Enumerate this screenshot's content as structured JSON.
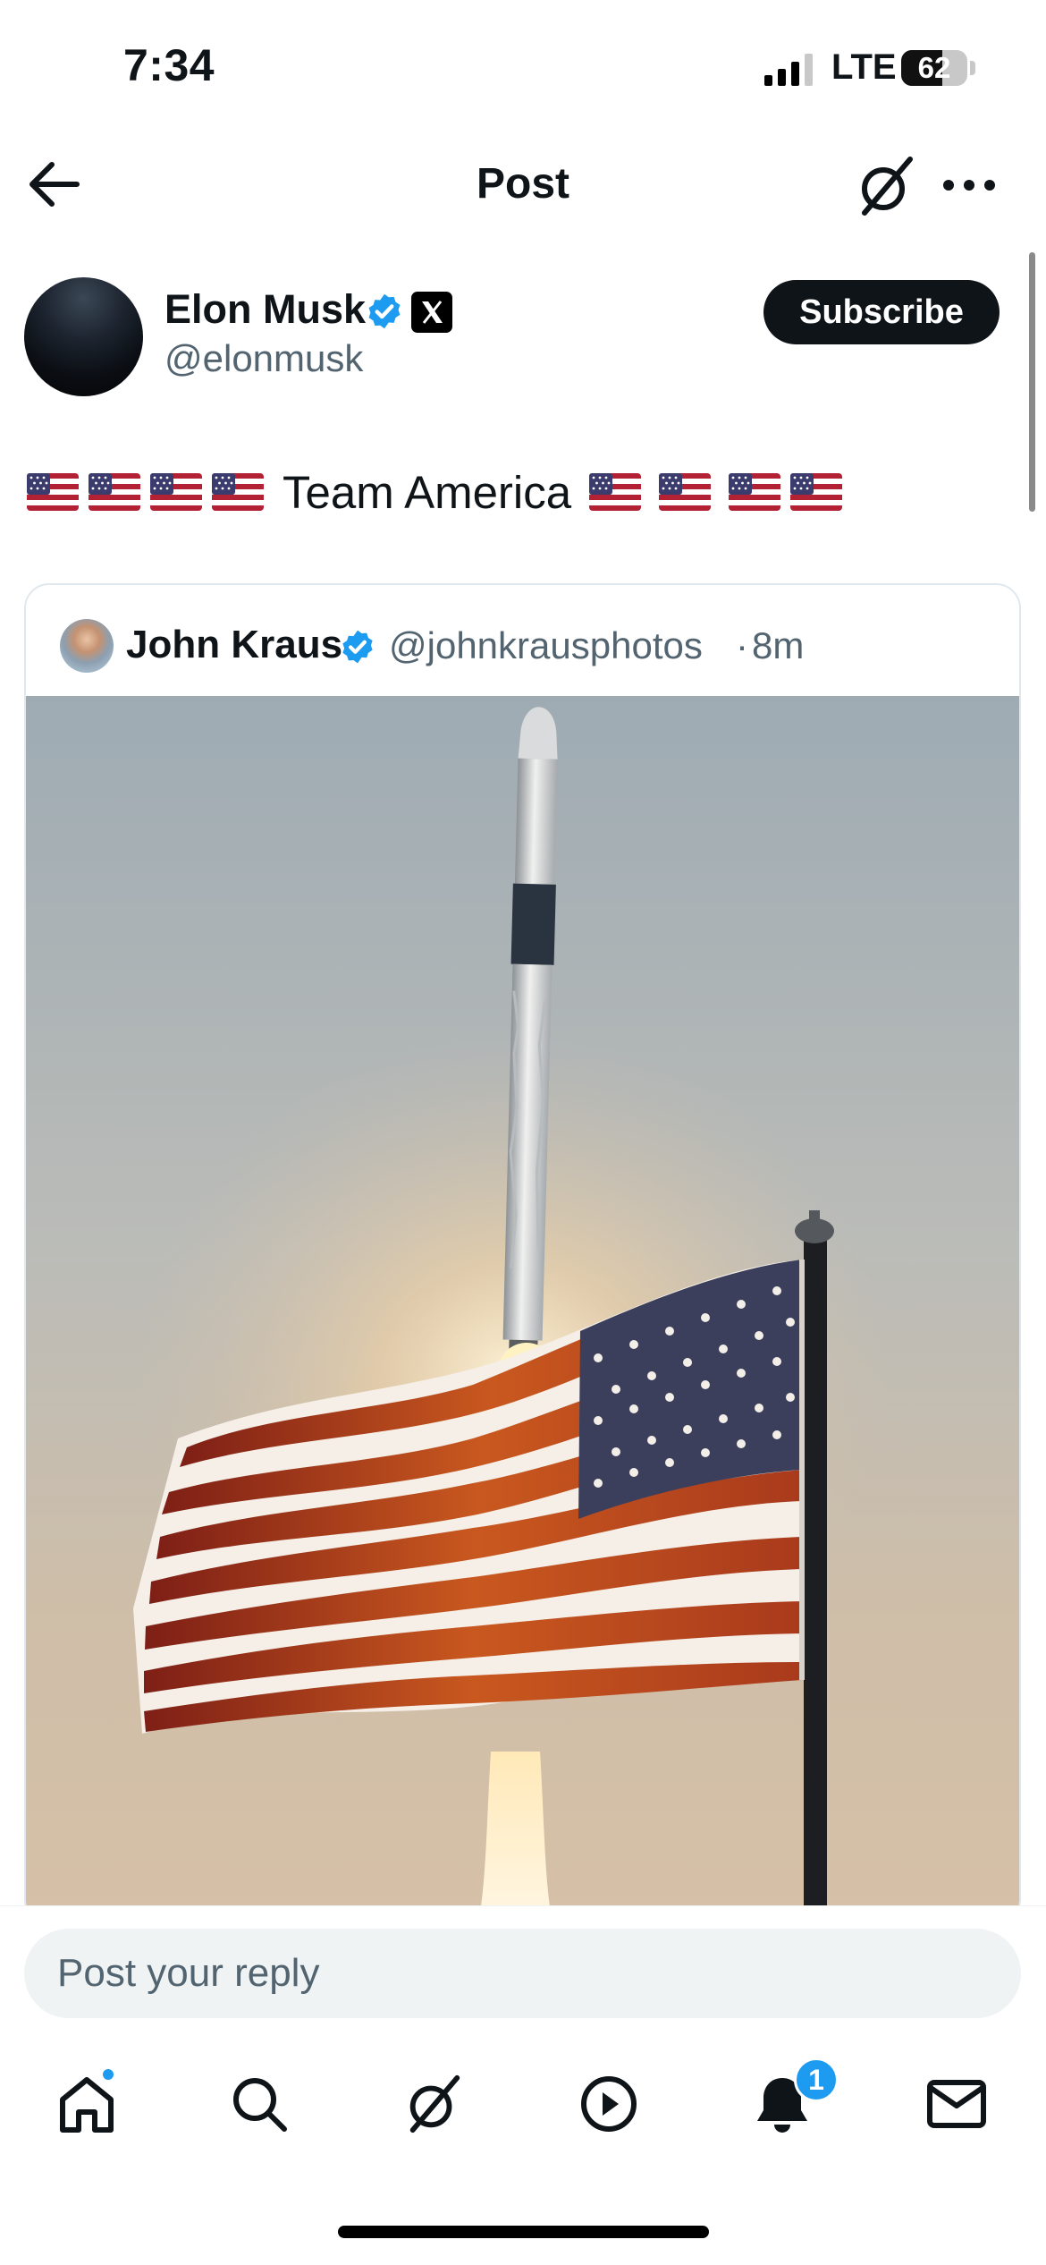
{
  "status_bar": {
    "time": "7:34",
    "network": "LTE",
    "battery": "62",
    "battery_level": 0.62
  },
  "header": {
    "title": "Post",
    "back_icon": "arrow-left-icon",
    "grok_icon": "grok-icon",
    "more_icon": "more-horizontal-icon"
  },
  "post": {
    "author_name": "Elon Musk",
    "author_handle": "@elonmusk",
    "verified": true,
    "subscribe_label": "Subscribe",
    "text": "Team America",
    "flags_before": 4,
    "flags_after": 4
  },
  "quoted_post": {
    "author_name": "John Kraus",
    "author_handle": "@johnkrausphotos",
    "separator": "·",
    "time": "8m",
    "image_icon": "rocket-launch-with-american-flag"
  },
  "reply": {
    "placeholder": "Post your reply"
  },
  "tab_bar": {
    "items": [
      "home-icon",
      "search-icon",
      "grok-icon",
      "video-icon",
      "bell-icon",
      "mail-icon"
    ],
    "notifications_count": "1"
  },
  "colors": {
    "accent": "#1d9bf0",
    "text": "#0f1419",
    "secondary": "#536471"
  }
}
